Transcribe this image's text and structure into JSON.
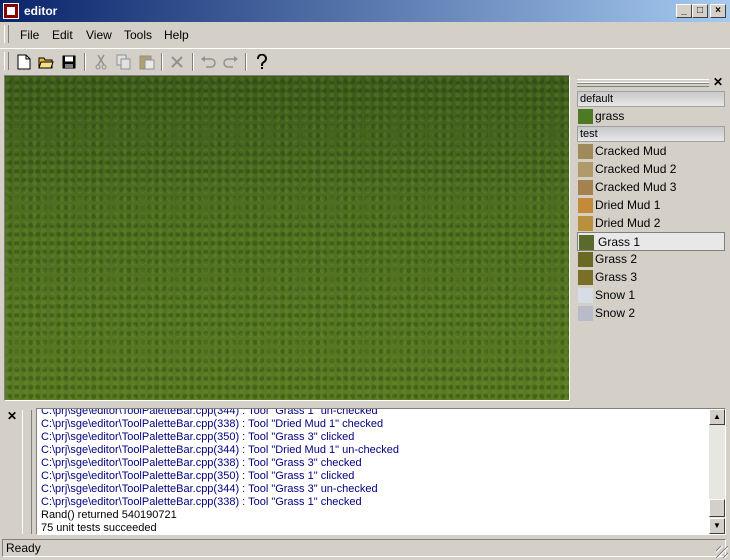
{
  "window": {
    "title": "editor"
  },
  "menu": [
    "File",
    "Edit",
    "View",
    "Tools",
    "Help"
  ],
  "palette": {
    "groups": [
      {
        "name": "default",
        "items": [
          {
            "label": "grass",
            "color": "#4e7a24"
          }
        ]
      },
      {
        "name": "test",
        "items": [
          {
            "label": "Cracked Mud",
            "color": "#a08a5a"
          },
          {
            "label": "Cracked Mud 2",
            "color": "#b09a6a"
          },
          {
            "label": "Cracked Mud 3",
            "color": "#a48250"
          },
          {
            "label": "Dried Mud 1",
            "color": "#c48a3a"
          },
          {
            "label": "Dried Mud 2",
            "color": "#b8903e"
          },
          {
            "label": "Grass 1",
            "color": "#5a6a2a"
          },
          {
            "label": "Grass 2",
            "color": "#6a6a24"
          },
          {
            "label": "Grass 3",
            "color": "#7a6e28"
          },
          {
            "label": "Snow 1",
            "color": "#d8dce4"
          },
          {
            "label": "Snow 2",
            "color": "#b8bcc8"
          }
        ]
      }
    ],
    "selected": "Grass 1"
  },
  "log": {
    "lines": [
      "C:\\prj\\sge\\editor\\ToolPaletteBar.cpp(344) : Tool \"Grass 1\" un-checked",
      "C:\\prj\\sge\\editor\\ToolPaletteBar.cpp(338) : Tool \"Dried Mud 1\" checked",
      "C:\\prj\\sge\\editor\\ToolPaletteBar.cpp(350) : Tool \"Grass 3\" clicked",
      "C:\\prj\\sge\\editor\\ToolPaletteBar.cpp(344) : Tool \"Dried Mud 1\" un-checked",
      "C:\\prj\\sge\\editor\\ToolPaletteBar.cpp(338) : Tool \"Grass 3\" checked",
      "C:\\prj\\sge\\editor\\ToolPaletteBar.cpp(350) : Tool \"Grass 1\" clicked",
      "C:\\prj\\sge\\editor\\ToolPaletteBar.cpp(344) : Tool \"Grass 3\" un-checked",
      "C:\\prj\\sge\\editor\\ToolPaletteBar.cpp(338) : Tool \"Grass 1\" checked",
      "Rand() returned 540190721",
      "75 unit tests succeeded"
    ],
    "link_color": "#00007f"
  },
  "status": {
    "text": "Ready"
  }
}
